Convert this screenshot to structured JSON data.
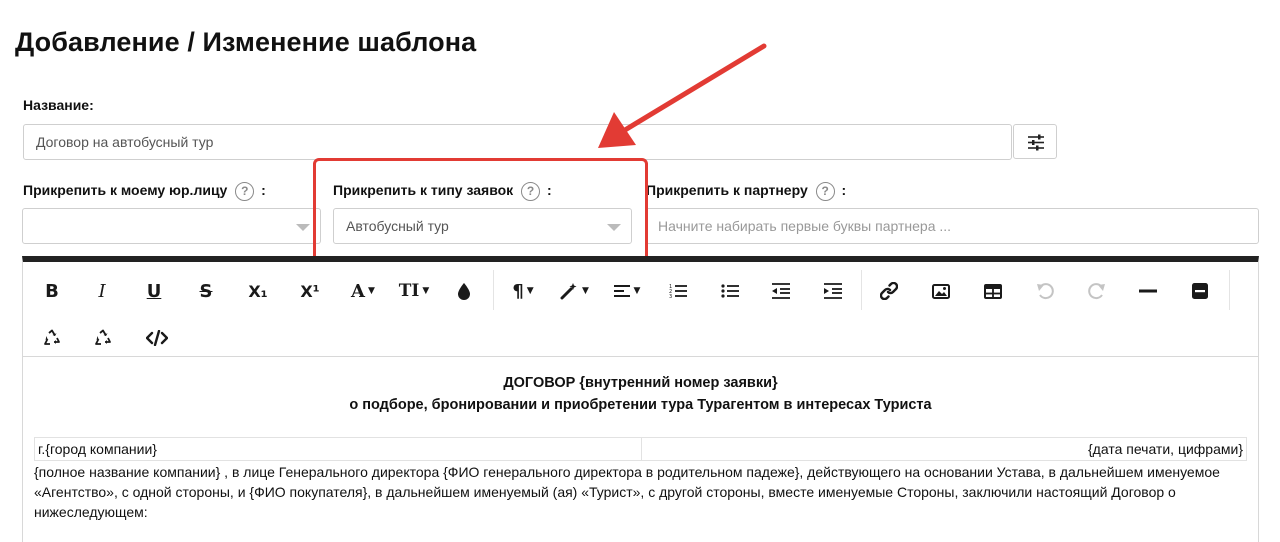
{
  "page": {
    "title": "Добавление / Изменение шаблона"
  },
  "name_field": {
    "label": "Название:",
    "value": "Договор на автобусный тур"
  },
  "attach": {
    "legal_entity": {
      "label": "Прикрепить к моему юр.лицу",
      "help": "?",
      "colon": ":",
      "value": ""
    },
    "request_type": {
      "label": "Прикрепить к типу заявок",
      "help": "?",
      "colon": ":",
      "value": "Автобусный тур"
    },
    "partner": {
      "label": "Прикрепить к партнеру",
      "help": "?",
      "colon": ":",
      "placeholder": "Начните набирать первые буквы партнера ..."
    }
  },
  "toolbar": {
    "bold": "B",
    "italic": "I",
    "underline": "U",
    "strike": "S",
    "subscript": "X₁",
    "superscript": "X¹",
    "font_color": "A",
    "font_size": "TI"
  },
  "document": {
    "title_line1": "ДОГОВОР {внутренний номер заявки}",
    "title_line2": "о подборе, бронировании и приобретении тура Турагентом в интересах Туриста",
    "city": "г.{город компании}",
    "date": "{дата печати, цифрами}",
    "paragraph": "{полное название компании} , в лице Генерального директора {ФИО генерального директора в родительном падеже}, действующего на основании Устава, в дальнейшем именуемое «Агентство», с одной стороны, и {ФИО покупателя}, в дальнейшем именуемый (ая) «Турист», с другой стороны, вместе именуемые Стороны, заключили настоящий Договор о нижеследующем:"
  },
  "colors": {
    "annotation": "#e23b34",
    "toolbar_top": "#222222"
  }
}
